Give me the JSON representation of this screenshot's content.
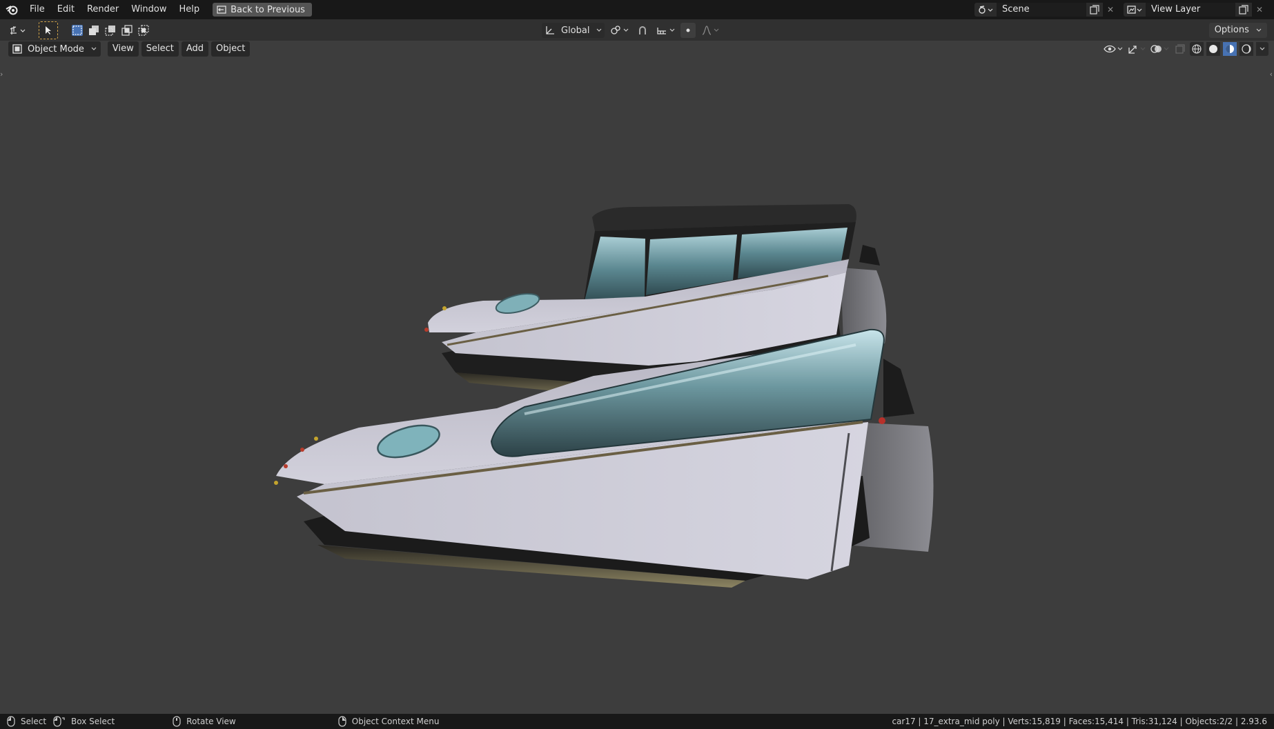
{
  "menubar": {
    "items": [
      "File",
      "Edit",
      "Render",
      "Window",
      "Help"
    ],
    "back_button": "Back to Previous",
    "scene_name": "Scene",
    "view_layer_name": "View Layer"
  },
  "toolheader": {
    "transform_orientation": "Global",
    "options_label": "Options"
  },
  "viewport_header": {
    "mode": "Object Mode",
    "menus": [
      "View",
      "Select",
      "Add",
      "Object"
    ]
  },
  "statusbar": {
    "select": "Select",
    "box_select": "Box Select",
    "rotate_view": "Rotate View",
    "context_menu": "Object Context Menu",
    "stats": "car17 | 17_extra_mid poly | Verts:15,819 | Faces:15,414 | Tris:31,124 | Objects:2/2 | 2.93.6"
  },
  "colors": {
    "accent": "#4772b3",
    "select_outline": "#d2a44a",
    "viewport_bg": "#3d3d3d"
  }
}
